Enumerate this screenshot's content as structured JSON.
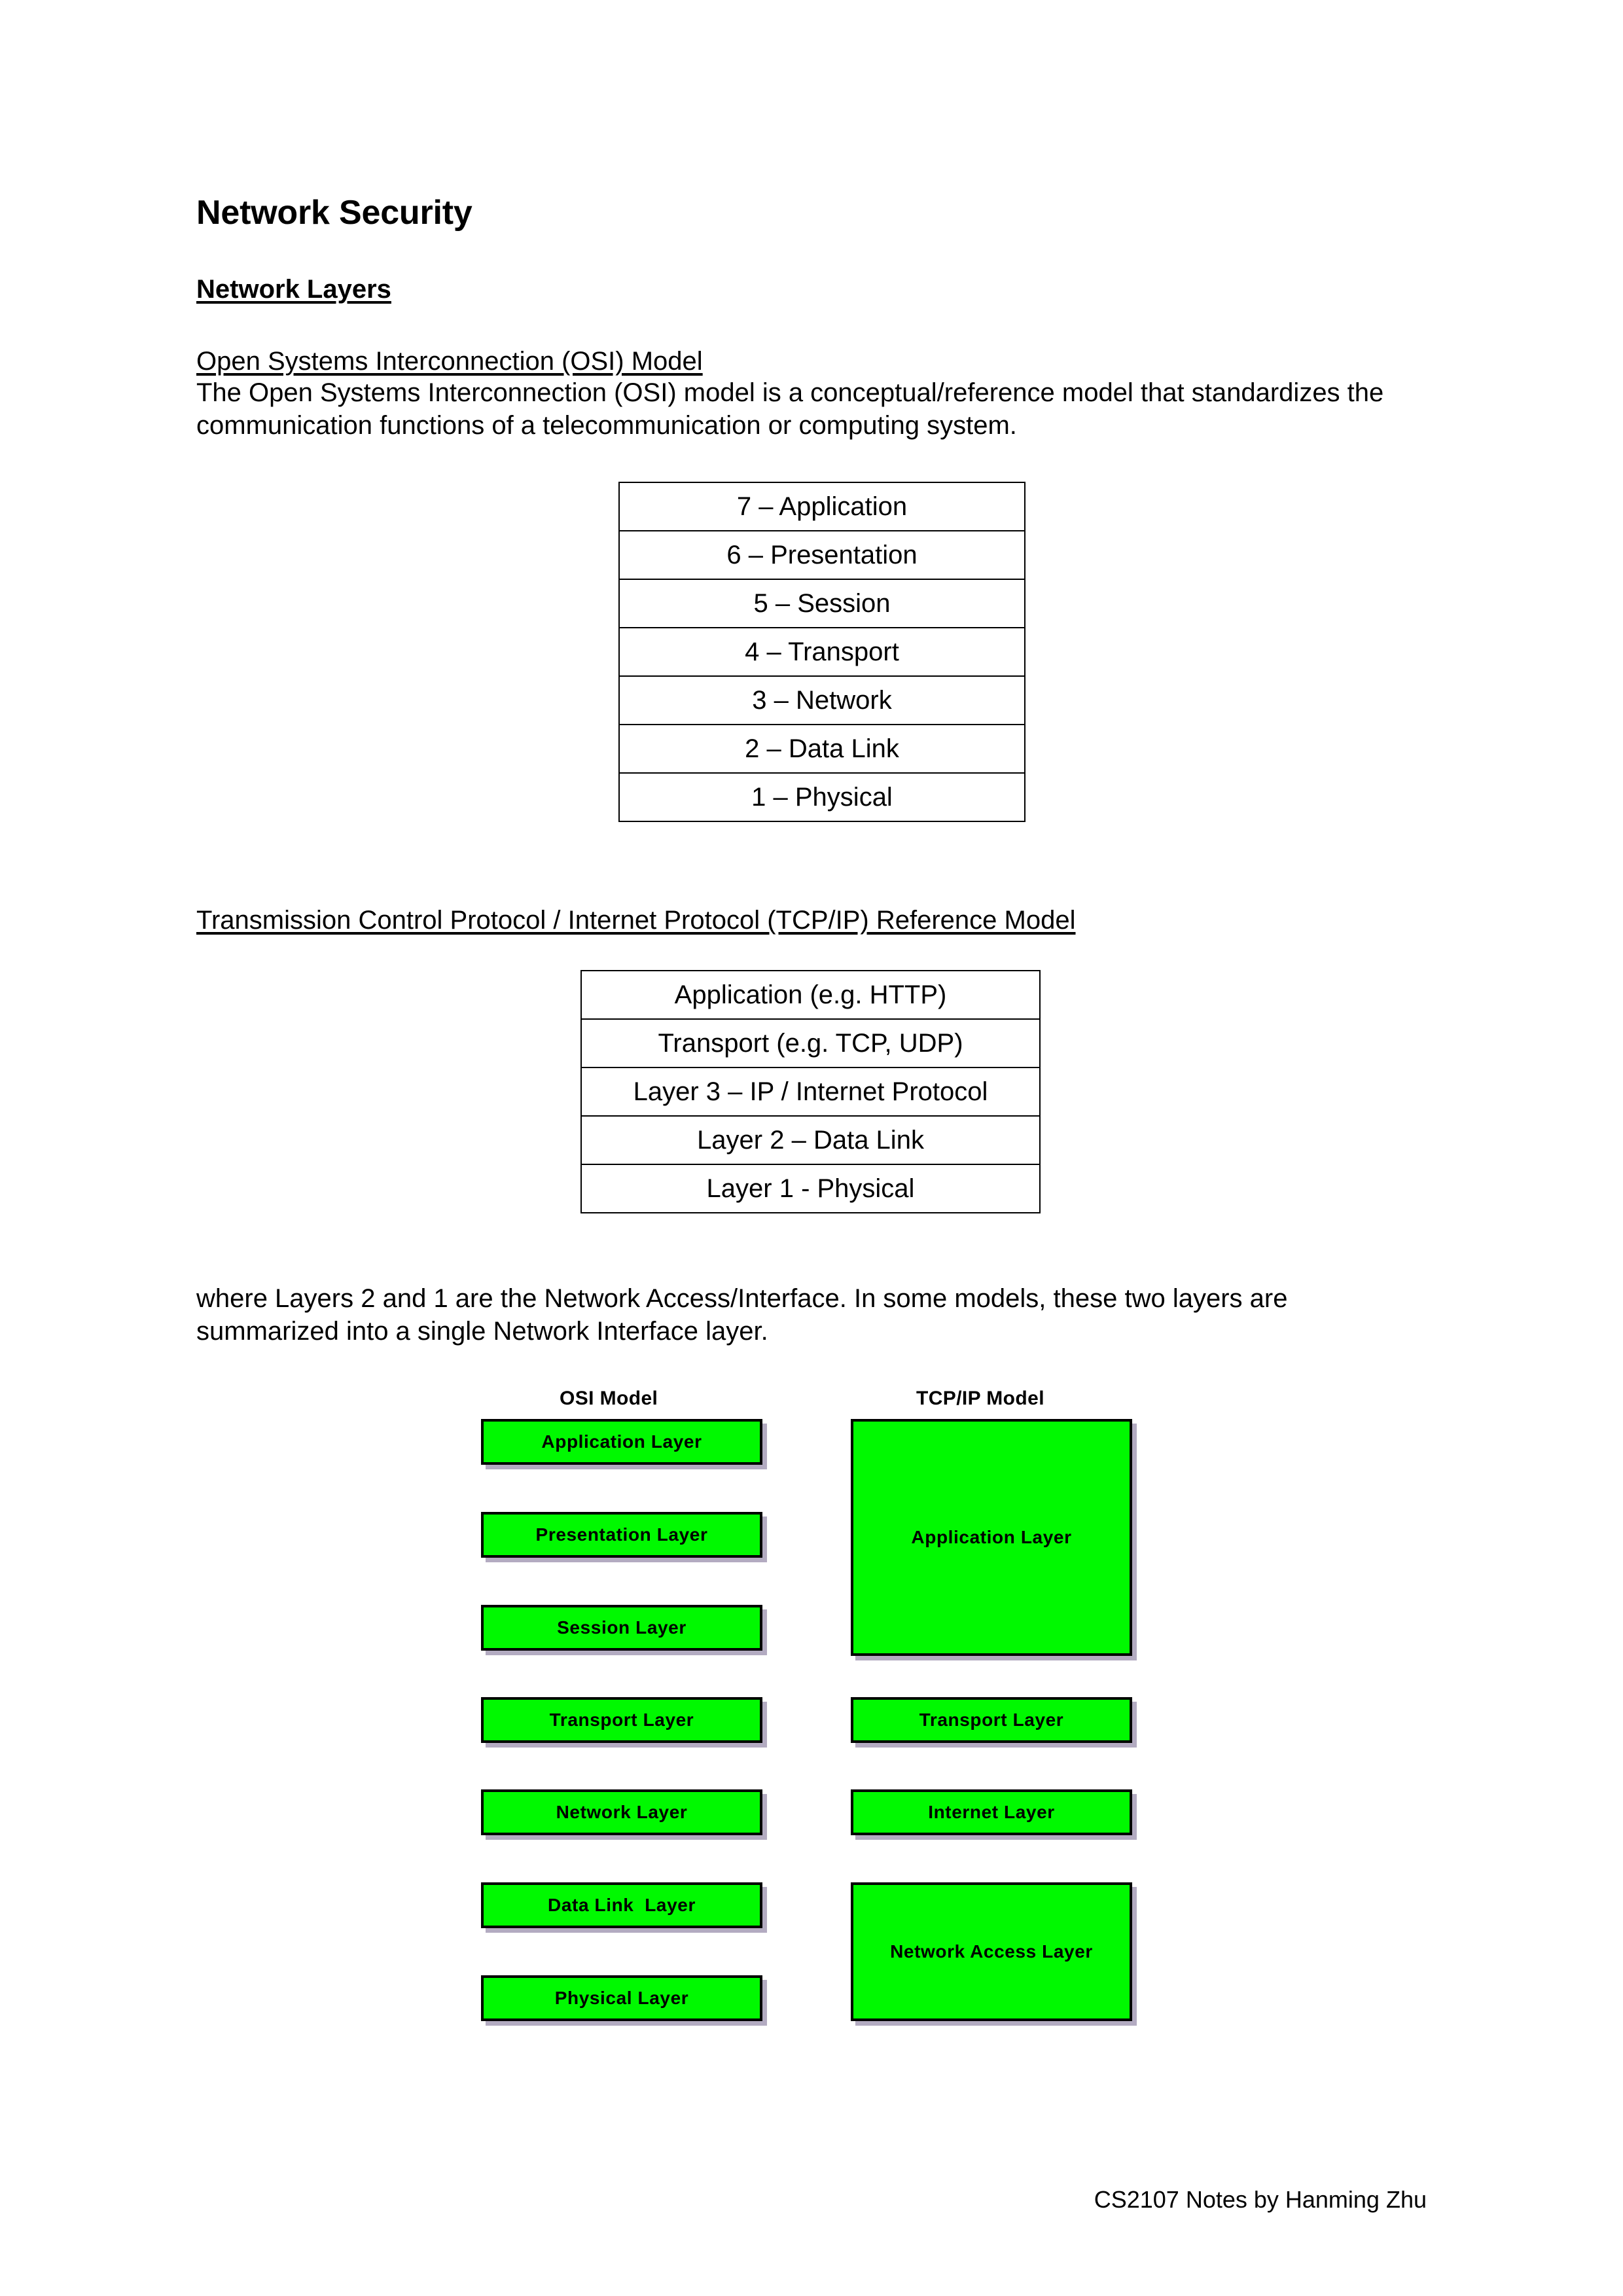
{
  "document": {
    "title": "Network Security",
    "section_heading": "Network Layers",
    "osi": {
      "heading": "Open Systems Interconnection (OSI) Model",
      "paragraph": "The Open Systems Interconnection (OSI) model is a conceptual/reference model that standardizes the communication functions of a telecommunication or computing system.",
      "layers": [
        "7 – Application",
        "6 – Presentation",
        "5 – Session",
        "4 – Transport",
        "3 – Network",
        "2 – Data Link",
        "1 – Physical"
      ]
    },
    "tcpip": {
      "heading": "Transmission Control Protocol / Internet Protocol (TCP/IP) Reference Model",
      "layers": [
        "Application (e.g. HTTP)",
        "Transport (e.g. TCP, UDP)",
        "Layer 3 – IP / Internet Protocol",
        "Layer 2 – Data Link",
        "Layer 1 - Physical"
      ],
      "note": "where Layers 2 and 1 are the Network Access/Interface. In some models, these two layers are summarized into a single Network Interface layer."
    },
    "diagram": {
      "osi_column_title": "OSI Model",
      "tcpip_column_title": "TCP/IP Model",
      "osi_boxes": [
        "Application Layer",
        "Presentation Layer",
        "Session Layer",
        "Transport Layer",
        "Network Layer",
        "Data Link  Layer",
        "Physical Layer"
      ],
      "tcpip_boxes": [
        "Application Layer",
        "Transport Layer",
        "Internet Layer",
        "Network Access Layer"
      ],
      "box_fill_color": "#00f900",
      "box_border_color": "#000000",
      "box_shadow_color": "#b3abc1"
    },
    "footer": "CS2107 Notes by Hanming Zhu"
  }
}
